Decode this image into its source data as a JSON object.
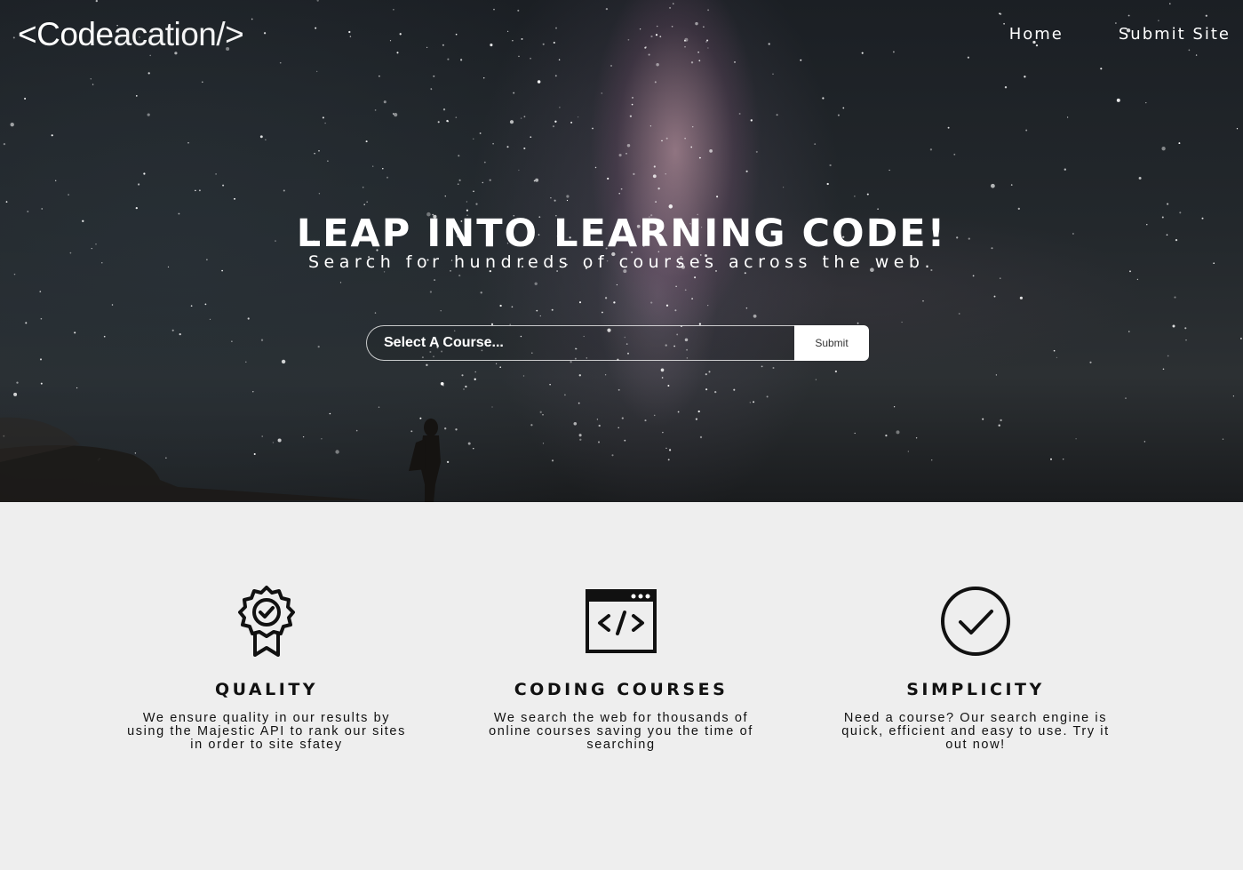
{
  "brand": {
    "logo_bold": "<Code",
    "logo_light": "acation/>"
  },
  "nav": {
    "items": [
      "Home",
      "Submit Site"
    ]
  },
  "hero": {
    "headline": "LEAP INTO LEARNING CODE!",
    "subheadline": "Search for hundreds of courses across the web."
  },
  "search": {
    "placeholder": "Select A Course...",
    "submit_label": "Submit"
  },
  "features": [
    {
      "icon": "award-ribbon-icon",
      "title": "QUALITY",
      "description": "We ensure quality in our results by using the Majestic API to rank our sites in order to site sfatey"
    },
    {
      "icon": "code-window-icon",
      "title": "CODING COURSES",
      "description": "We search the web for thousands of online courses saving you the time of searching"
    },
    {
      "icon": "check-circle-icon",
      "title": "SIMPLICITY",
      "description": "Need a course? Our search engine is quick, efficient and easy to use. Try it out now!"
    }
  ],
  "colors": {
    "features_background": "#eeeeee",
    "text_dark": "#111111",
    "text_light": "#ffffff"
  }
}
